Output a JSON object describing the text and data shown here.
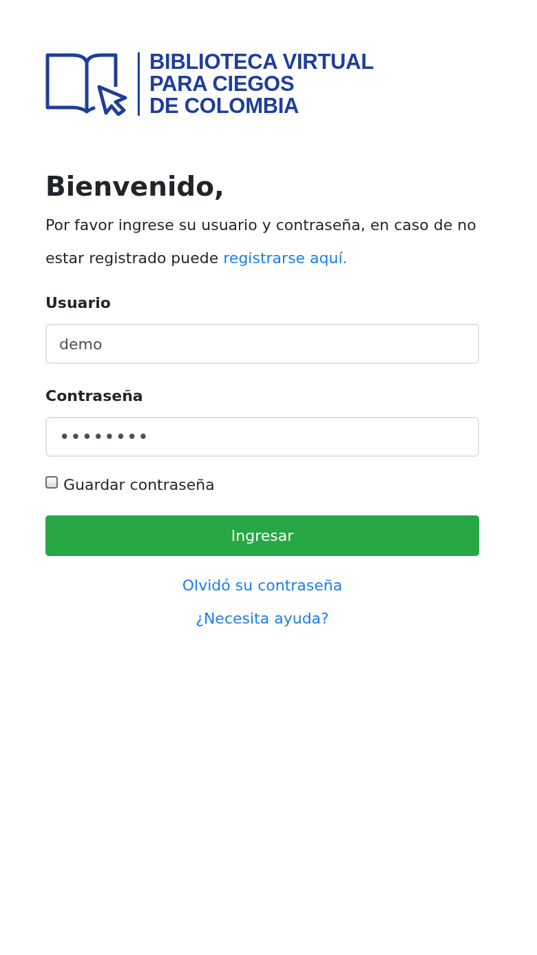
{
  "logo": {
    "lines": [
      "BIBLIOTECA VIRTUAL",
      "PARA CIEGOS",
      "DE COLOMBIA"
    ]
  },
  "heading": "Bienvenido,",
  "intro": {
    "text": "Por favor ingrese su usuario y contraseña, en caso de no estar registrado puede ",
    "link": "registrarse aquí."
  },
  "fields": [
    {
      "label": "Usuario",
      "value": "demo"
    },
    {
      "label": "Contraseña",
      "value": "••••••••"
    }
  ],
  "remember": {
    "label": "Guardar contraseña",
    "checked": false
  },
  "submit": "Ingresar",
  "links": [
    "Olvidó su contraseña",
    "¿Necesita ayuda?"
  ]
}
